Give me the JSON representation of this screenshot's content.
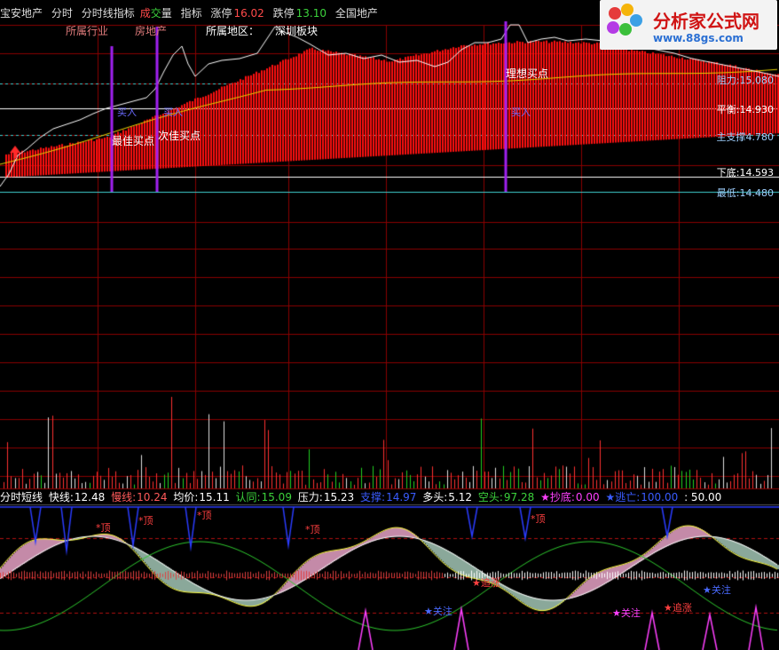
{
  "header": {
    "stock": "宝安地产",
    "tab_minute": "分时",
    "tab_indicator": "分时线指标",
    "cheng": "成",
    "jiao": "交",
    "liang": "量",
    "zhibiao": "指标",
    "up_limit_label": "涨停",
    "up_limit_value": "16.02",
    "down_limit_label": "跌停",
    "down_limit_value": "13.10",
    "market": "全国地产"
  },
  "tags": {
    "industry_label": "所属行业",
    "industry_value": "房地产",
    "region_label": "所属地区：",
    "region_value": "深圳板块"
  },
  "points": {
    "best_buy": "最佳买点",
    "second_buy": "次佳买点",
    "ideal_buy": "理想买点",
    "marker_a": "买入",
    "marker_b": "买入",
    "marker_c": "买入"
  },
  "levels": [
    {
      "label": "阻力:",
      "value": "15.080",
      "color": "#9fd0ff"
    },
    {
      "label": "平衡:",
      "value": "14.930",
      "color": "#ffffff"
    },
    {
      "label": "主支撑",
      "value": "4.780",
      "color": "#9fd0ff"
    },
    {
      "label": "下底:",
      "value": "14.593",
      "color": "#ffffff"
    },
    {
      "label": "最低:",
      "value": "14.480",
      "color": "#9fd0ff"
    }
  ],
  "indicator": {
    "name": "分时短线",
    "fast_label": "快线:",
    "fast_value": "12.48",
    "slow_label": "慢线:",
    "slow_value": "10.24",
    "avg_label": "均价:",
    "avg_value": "15.11",
    "agree_label": "认同:",
    "agree_value": "15.09",
    "pressure_label": "压力:",
    "pressure_value": "15.23",
    "support_label": "支撑:",
    "support_value": "14.97",
    "bull_label": "多头:",
    "bull_value": "5.12",
    "bear_label": "空头:",
    "bear_value": "97.28",
    "bottom_label": "★抄底:",
    "bottom_value": "0.00",
    "escape_label": "★逃亡:",
    "escape_value": "100.00",
    "mid_value": ": 50.00"
  },
  "annotations": {
    "top": "*顶",
    "chase": "★追涨",
    "attention": "★关注"
  },
  "logo": {
    "title": "分析家公式网",
    "url": "www.88gs.com"
  },
  "colors": {
    "red_fill": "#ff1010",
    "grid_red": "#8a0000",
    "purple": "#a020f0",
    "volume_red": "#ff3030",
    "volume_green": "#20d020",
    "cyan": "#40d0d0"
  }
}
